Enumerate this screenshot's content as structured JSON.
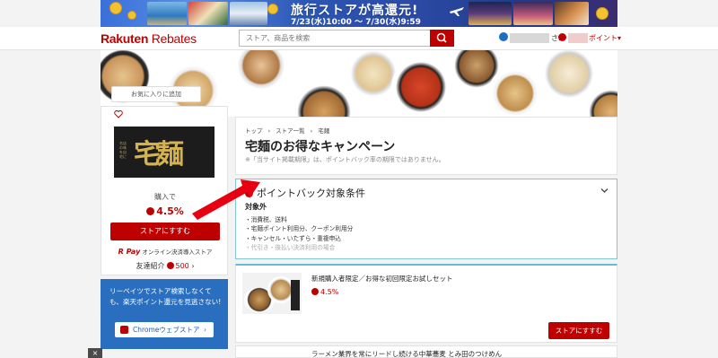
{
  "banner": {
    "title": "旅行ストアが高還元!",
    "dates": "7/23(水)10:00 ～ 7/30(水)9:59"
  },
  "header": {
    "logo_main": "Rakuten",
    "logo_sub": "Rebates",
    "search_placeholder": "ストア、商品を検索",
    "user_suffix": "さん",
    "points_label": "ポイント▾"
  },
  "hero": {
    "favorite_label": "お気に入りに追加"
  },
  "store": {
    "logo_kanji": "宅麺",
    "logo_small": "名店の味を自宅に",
    "buy_label": "購入で",
    "rate": "4.5%",
    "go_button": "ストアにすすむ",
    "rpay_brand": "R Pay",
    "rpay_text": "オンライン決済導入ストア",
    "referral_label": "友達紹介",
    "referral_points": "500",
    "referral_chevron": "›"
  },
  "chrome_promo": {
    "text": "リーベイツでストア検索しなくても、楽天ポイント還元を見逃さない!",
    "button_label": "Chromeウェブストア",
    "button_arrow": "›"
  },
  "close_label": "×",
  "main": {
    "breadcrumb": [
      "トップ",
      "›",
      "ストア一覧",
      "›",
      "宅麺"
    ],
    "title": "宅麺のお得なキャンペーン",
    "note": "※「当サイト掲載期限」は、ポイントバック率の期限ではありません。"
  },
  "conditions": {
    "heading": "ポイントバック対象条件",
    "subheading": "対象外",
    "items": [
      "・消費税、送料",
      "・宅麺ポイント利用分、クーポン利用分",
      "・キャンセル・いたずら・重複申込",
      "・代引き・後払い決済利用の場合"
    ]
  },
  "offer": {
    "title": "新規購入者限定／お得な初回限定お試しセット",
    "rate": "4.5%",
    "button": "ストアにすすむ"
  },
  "next_offer": {
    "title": "ラーメン業界を常にリードし続ける中華蕎麦 とみ田のつけめん"
  },
  "colors": {
    "brand_red": "#bf0000",
    "chrome_blue": "#2a6fbf",
    "cond_border": "#7fc7c9"
  }
}
